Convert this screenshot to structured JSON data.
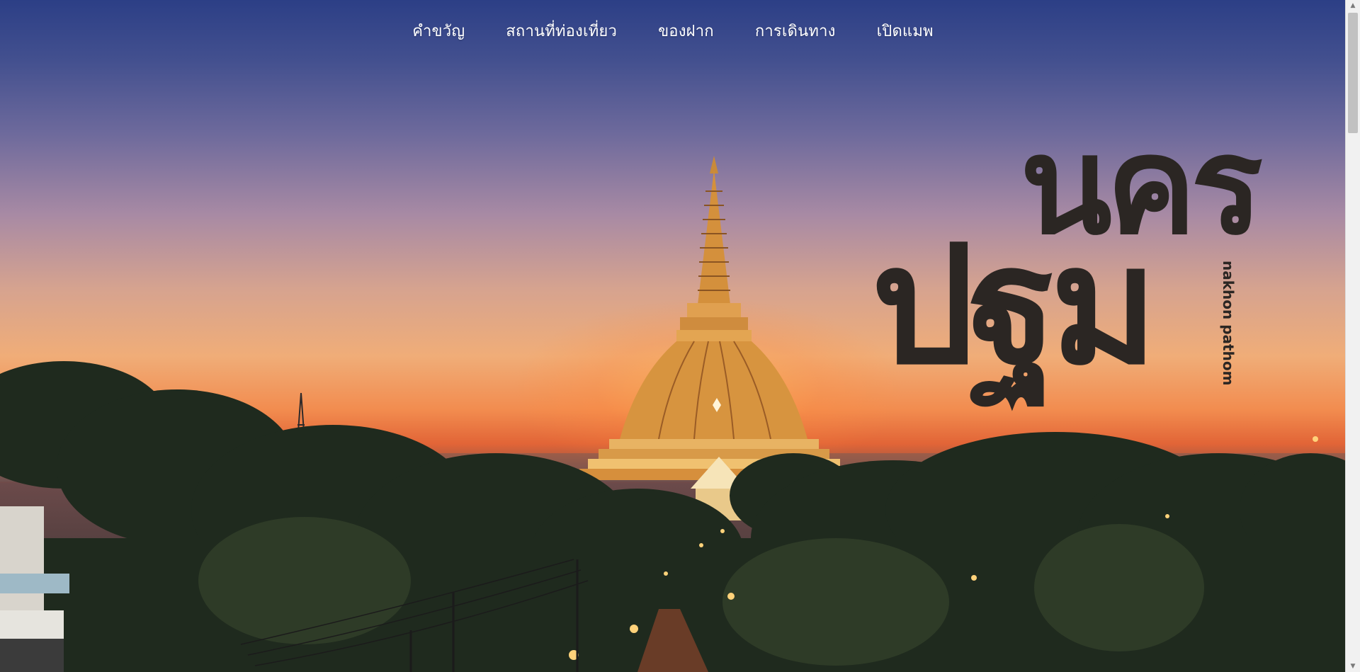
{
  "nav": {
    "items": [
      {
        "label": "คำขวัญ"
      },
      {
        "label": "สถานที่ท่องเที่ยว"
      },
      {
        "label": "ของฝาก"
      },
      {
        "label": "การเดินทาง"
      },
      {
        "label": "เปิดแมพ"
      }
    ]
  },
  "hero": {
    "title_line1": "นคร",
    "title_line2": "ปฐม",
    "subtitle": "nakhon pathom"
  },
  "scrollbar": {
    "up": "▲",
    "down": "▼"
  },
  "colors": {
    "title": "#2b2623",
    "nav_text": "#ffffff",
    "sky_top": "#2c3f86",
    "horizon": "#f28c4f"
  }
}
